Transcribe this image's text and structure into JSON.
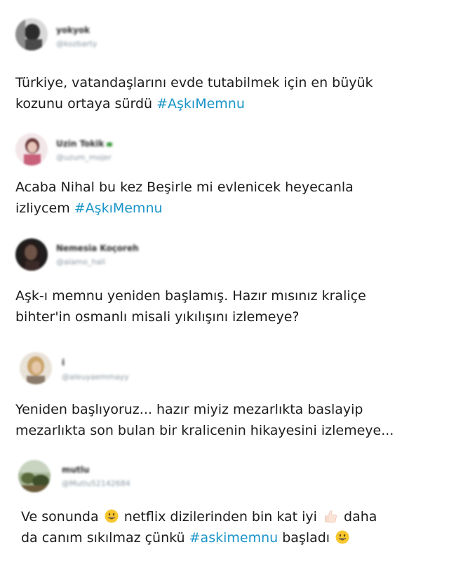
{
  "tweets": [
    {
      "display_name": "yokyok",
      "handle": "@kozbarty",
      "avatar_icon": "user-avatar-icon",
      "text_line1": "Türkiye, vatandaşlarını evde tutabilmek için en büyük",
      "text_line2_pre": "kozunu ortaya sürdü ",
      "hashtag": "#AşkıMemnu"
    },
    {
      "display_name": "Uzin Tokik",
      "handle": "@uzum_mojer",
      "avatar_icon": "user-avatar-icon",
      "text_line1": "Acaba Nihal bu kez Beşirle mi evlenicek heyecanla",
      "text_line2_pre": "izliycem ",
      "hashtag": "#AşkıMemnu"
    },
    {
      "display_name": "Nemesia Koçoreh",
      "handle": "@alamo_hali",
      "avatar_icon": "user-avatar-icon",
      "text_line1": "Aşk-ı memnu yeniden başlamış. Hazır mısınız kraliçe",
      "text_line2": "bihter'in osmanlı misali yıkılışını izlemeye?"
    },
    {
      "display_name": "i",
      "handle": "@aleuyaemmayy",
      "avatar_icon": "user-avatar-icon",
      "text_line1": "Yeniden başlıyoruz... hazır miyiz mezarlıkta baslayip",
      "text_line2": "mezarlıkta son bulan bir kralicenin hikayesini izlemeye..."
    },
    {
      "display_name": "mutlu",
      "handle": "@Mutlu52142684",
      "avatar_icon": "user-avatar-icon",
      "text_line1_a": "Ve sonunda ",
      "text_line1_b": " netflix dizilerinden bin kat iyi ",
      "text_line1_c": " daha",
      "text_line2_pre": "da canım sıkılmaz çünkü ",
      "hashtag": "#askimemnu",
      "text_line2_post": " başladı ",
      "emoji_1": "grinning-face-emoji",
      "emoji_2": "thumbs-up-emoji"
    }
  ],
  "colors": {
    "hashtag": "#1b95c8",
    "text": "#1c1c1c",
    "handle": "#8a96a0",
    "emoji": "#f7c72f"
  }
}
